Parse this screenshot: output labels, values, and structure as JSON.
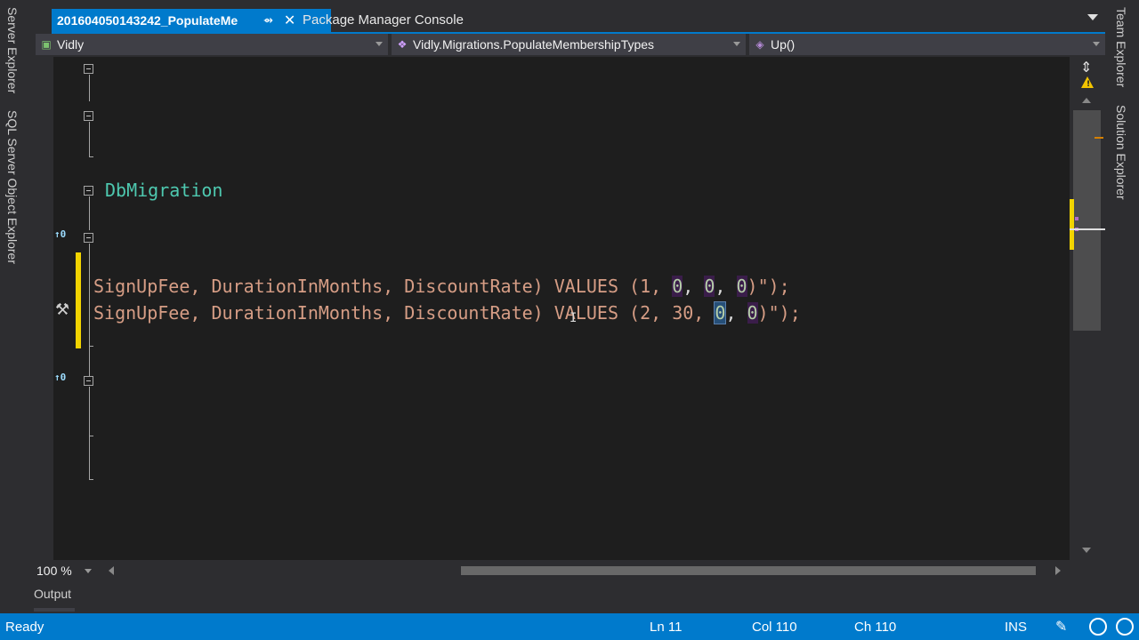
{
  "side_tabs": {
    "left": [
      "Server Explorer",
      "SQL Server Object Explorer"
    ],
    "right": [
      "Team Explorer",
      "Solution Explorer"
    ]
  },
  "tabs": {
    "active": "201604050143242_PopulateMe",
    "other": "Package Manager Console",
    "pin_icon": "⇴",
    "close_icon": "✕"
  },
  "navbar": {
    "project": "Vidly",
    "class": "Vidly.Migrations.PopulateMembershipTypes",
    "member": "Up()"
  },
  "editor": {
    "class_name": "DbMigration",
    "codelens_1": "↑0",
    "codelens_2": "↑0",
    "line1": {
      "prefix": "SignUpFee, DurationInMonths, DiscountRate) VALUES (1, ",
      "v2": "0",
      "v3": "0",
      "v4": "0",
      "suffix": ")\");"
    },
    "line2": {
      "prefix": "SignUpFee, DurationInMonths, DiscountRate) VALUES (2, 30, ",
      "v3": "0",
      "v4": "0",
      "suffix": ")\");"
    }
  },
  "zoom": "100 %",
  "output_tab": "Output",
  "status": {
    "ready": "Ready",
    "ln": "Ln 11",
    "col": "Col 110",
    "ch": "Ch 110",
    "mode": "INS"
  },
  "colors": {
    "accent": "#007acc",
    "change_bar": "#f2d400",
    "editor_bg": "#1e1e1e"
  }
}
